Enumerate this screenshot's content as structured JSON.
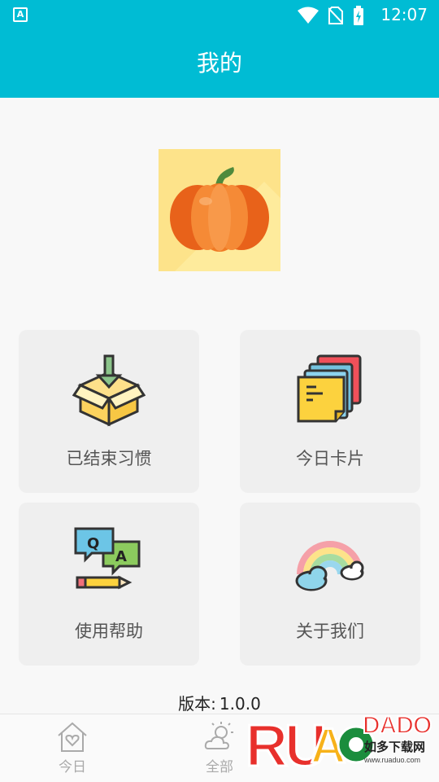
{
  "status_bar": {
    "app_badge": "A",
    "time": "12:07"
  },
  "header": {
    "title": "我的"
  },
  "menu": [
    {
      "label": "已结束习惯",
      "icon": "box-download-icon"
    },
    {
      "label": "今日卡片",
      "icon": "sticky-notes-icon"
    },
    {
      "label": "使用帮助",
      "icon": "qa-chat-icon"
    },
    {
      "label": "关于我们",
      "icon": "rainbow-cloud-icon"
    }
  ],
  "version": {
    "label": "版本:",
    "value": "1.0.0"
  },
  "bottom_nav": [
    {
      "label": "今日",
      "icon": "house-heart-icon"
    },
    {
      "label": "全部",
      "icon": "sun-cloud-icon"
    }
  ],
  "watermark": {
    "logo_text": "RUANDADUO",
    "cn_text": "如多下载网",
    "url": "www.ruaduo.com"
  },
  "colors": {
    "primary": "#00bcd4",
    "card_bg": "#efefef",
    "avatar_bg": "#fde38a",
    "pumpkin": "#f07a24"
  }
}
